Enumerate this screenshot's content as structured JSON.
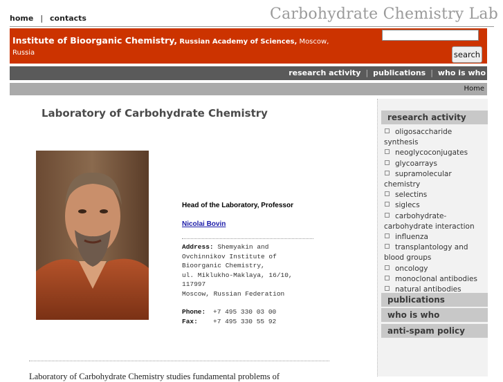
{
  "header": {
    "nav": [
      "home",
      "contacts"
    ],
    "nav_sep": "|",
    "site_title": "Carbohydrate Chemistry Lab",
    "institute_name": "Institute of Bioorganic Chemistry,",
    "academy": "Russian Academy of Sciences,",
    "city": "Moscow, Russia",
    "search_placeholder": "",
    "search_button": "search"
  },
  "main_nav": {
    "items": [
      "research activity",
      "publications",
      "who is who"
    ],
    "sep": "|"
  },
  "breadcrumb": "Home",
  "main": {
    "heading": "Laboratory of Carbohydrate Chemistry",
    "head_title": "Head of the Laboratory, Professor",
    "head_name": "Nicolai Bovin",
    "address_label": "Address:",
    "address_lines": [
      "Shemyakin and",
      "Ovchinnikov Institute of",
      "Bioorganic Chemistry,",
      "ul. Miklukho-Maklaya, 16/10,",
      "117997",
      "Moscow, Russian Federation"
    ],
    "phone_label": "Phone:",
    "phone": "+7 495 330 03 00",
    "fax_label": "Fax:",
    "fax": "+7 495 330 55 92",
    "intro_text": "Laboratory of Carbohydrate Chemistry studies fundamental problems of"
  },
  "sidebar": {
    "research_heading": "research activity",
    "research_items": [
      "oligosaccharide synthesis",
      "neoglycoconjugates",
      "glycoarrays",
      "supramolecular chemistry",
      "selectins",
      "siglecs",
      "carbohydrate-carbohydrate interaction",
      "influenza",
      "transplantology and blood groups",
      "oncology",
      "monoclonal antibodies",
      "natural antibodies"
    ],
    "publications_heading": "publications",
    "who_heading": "who is who",
    "antispam_heading": "anti-spam policy"
  },
  "colors": {
    "header_red": "#cc3300",
    "nav_dark": "#5a5a5a",
    "crumb_gray": "#aaaaaa",
    "link_blue": "#1a1aa8"
  }
}
